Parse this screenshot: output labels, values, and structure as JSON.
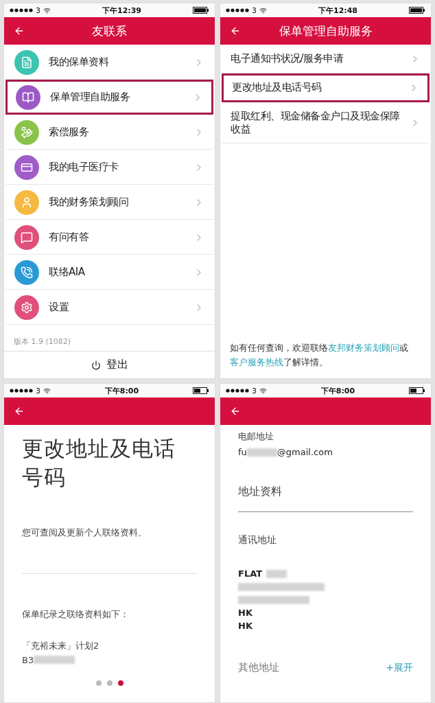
{
  "panels": [
    {
      "kind": "menu",
      "status": {
        "carrier": "3",
        "time": "下午12:39"
      },
      "header": {
        "title": "友联系"
      },
      "items": [
        {
          "label": "我的保单资料",
          "color": "#3cc4b0",
          "selected": false
        },
        {
          "label": "保单管理自助服务",
          "color": "#9b59c6",
          "selected": true
        },
        {
          "label": "索偿服务",
          "color": "#8bc34a",
          "selected": false
        },
        {
          "label": "我的电子医疗卡",
          "color": "#a05cc8",
          "selected": false
        },
        {
          "label": "我的财务策划顾问",
          "color": "#f5b942",
          "selected": false
        },
        {
          "label": "有问有答",
          "color": "#e0507a",
          "selected": false
        },
        {
          "label": "联络AIA",
          "color": "#2a9ad6",
          "selected": false
        },
        {
          "label": "设置",
          "color": "#e0507a",
          "selected": false
        }
      ],
      "version": "版本 1.9 (1082)",
      "logout": "登出"
    },
    {
      "kind": "submenu",
      "status": {
        "carrier": "3",
        "time": "下午12:48"
      },
      "header": {
        "title": "保单管理自助服务"
      },
      "items": [
        {
          "label": "电子通知书状况/服务申请",
          "selected": false
        },
        {
          "label": "更改地址及电话号码",
          "selected": true
        },
        {
          "label": "提取红利、现金储备金户口及现金保障收益",
          "selected": false
        }
      ],
      "note": [
        {
          "text": "如有任何查询，欢迎联络",
          "link": false
        },
        {
          "text": "友邦财务策划顾问",
          "link": true
        },
        {
          "text": "或",
          "link": false
        },
        {
          "text": "客户服务热线",
          "link": true
        },
        {
          "text": "了解详情。",
          "link": false
        }
      ]
    },
    {
      "kind": "intro",
      "status": {
        "carrier": "3",
        "time": "下午8:00"
      },
      "title": "更改地址及电话号码",
      "intro": "您可查阅及更新个人联络资料。",
      "subheading": "保单纪录之联络资料如下：",
      "plan": "「充裕未来」计划2",
      "policy": "B3",
      "dots": [
        {
          "selected": false
        },
        {
          "selected": false
        },
        {
          "selected": true
        }
      ]
    },
    {
      "kind": "details",
      "status": {
        "carrier": "3",
        "time": "下午8:00"
      },
      "email_label": "电邮地址",
      "email_start": "fu",
      "email_end": "@gmail.com",
      "section": "地址资料",
      "address_label": "通讯地址",
      "address": [
        {
          "kind": "text",
          "text": "FLAT",
          "redacted": true
        },
        {
          "kind": "redacted"
        },
        {
          "kind": "redacted"
        },
        {
          "kind": "text",
          "text": "HK",
          "redacted": false
        },
        {
          "kind": "text",
          "text": "HK",
          "redacted": false
        }
      ],
      "other_label": "其他地址",
      "expand": "+展开"
    }
  ]
}
